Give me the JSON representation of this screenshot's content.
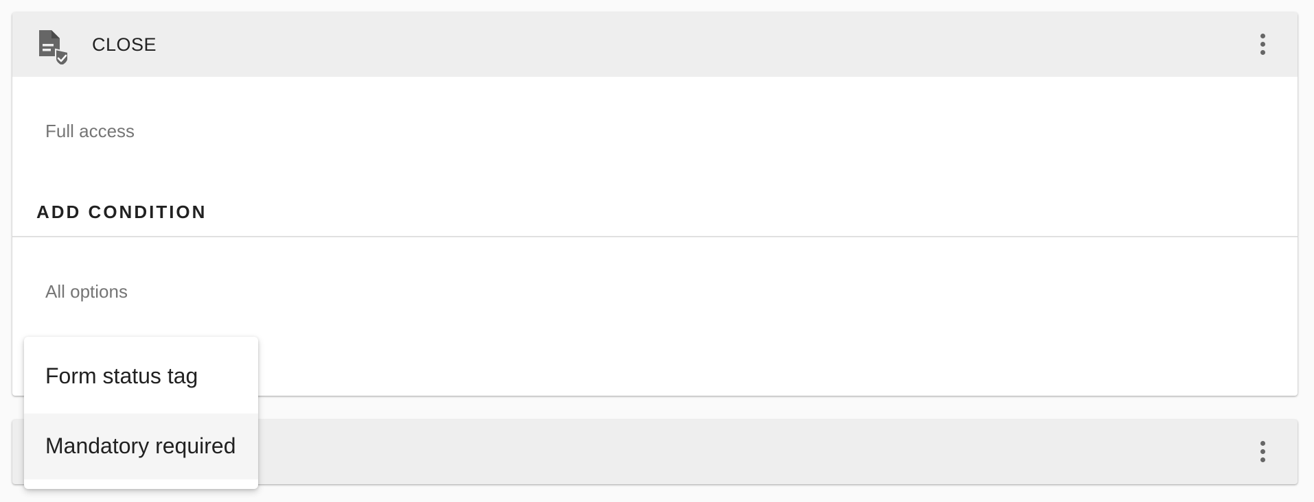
{
  "card1": {
    "header": {
      "icon": "document-check-icon",
      "title": "CLOSE",
      "more_icon": "more-vert-icon"
    },
    "access_text": "Full access",
    "add_condition_label": "ADD CONDITION",
    "options_text": "All options"
  },
  "card2": {
    "more_icon": "more-vert-icon"
  },
  "menu": {
    "items": [
      {
        "label": "Form status tag",
        "highlighted": false
      },
      {
        "label": "Mandatory required",
        "highlighted": true
      }
    ]
  },
  "colors": {
    "header_bg": "#eeeeee",
    "icon": "#666666",
    "muted_text": "#757575",
    "primary_text": "#212121",
    "highlight_bg": "#f5f5f5"
  }
}
